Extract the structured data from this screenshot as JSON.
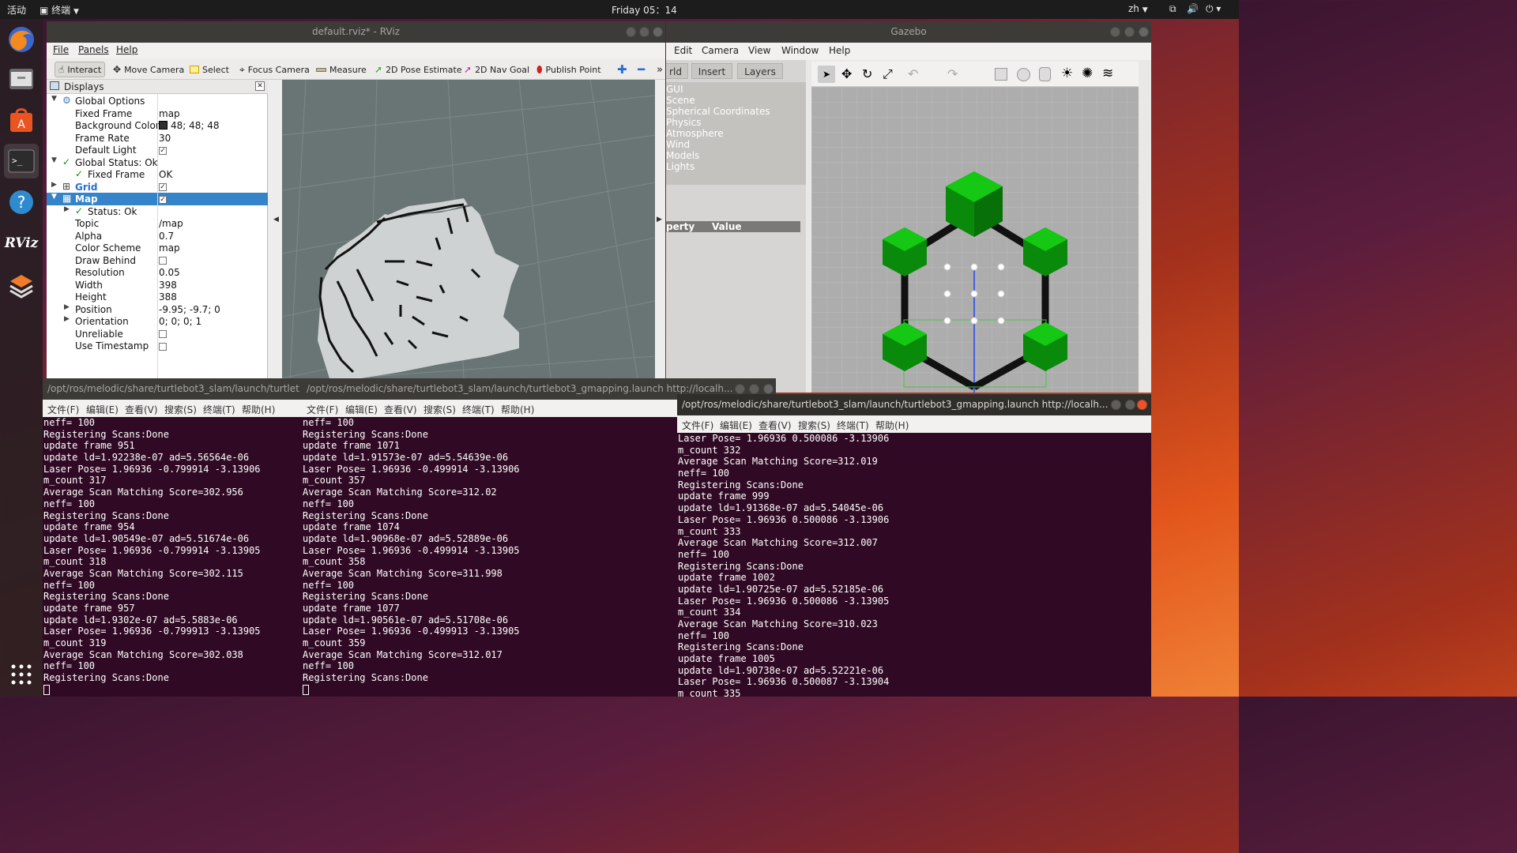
{
  "topbar": {
    "activities": "活动",
    "app_menu": "终端",
    "clock": "Friday 05：14",
    "lang": "zh"
  },
  "dock": {
    "items": [
      "firefox-icon",
      "files-icon",
      "software-icon",
      "terminal-icon",
      "help-icon",
      "rviz-icon",
      "workspace-icon",
      "show-apps-icon"
    ],
    "rviz_label": "RViz"
  },
  "rviz": {
    "title": "default.rviz* - RViz",
    "menu": [
      "File",
      "Panels",
      "Help"
    ],
    "tools": [
      "Interact",
      "Move Camera",
      "Select",
      "Focus Camera",
      "Measure",
      "2D Pose Estimate",
      "2D Nav Goal",
      "Publish Point"
    ],
    "panel_title": "Displays",
    "rows": [
      {
        "name": "Global Options",
        "value": ""
      },
      {
        "name": "Fixed Frame",
        "value": "map"
      },
      {
        "name": "Background Color",
        "value": "48; 48; 48"
      },
      {
        "name": "Frame Rate",
        "value": "30"
      },
      {
        "name": "Default Light",
        "value": ""
      },
      {
        "name": "Global Status: Ok",
        "value": ""
      },
      {
        "name": "Fixed Frame",
        "value": "OK"
      },
      {
        "name": "Grid",
        "value": ""
      },
      {
        "name": "Map",
        "value": ""
      },
      {
        "name": "Status: Ok",
        "value": ""
      },
      {
        "name": "Topic",
        "value": "/map"
      },
      {
        "name": "Alpha",
        "value": "0.7"
      },
      {
        "name": "Color Scheme",
        "value": "map"
      },
      {
        "name": "Draw Behind",
        "value": ""
      },
      {
        "name": "Resolution",
        "value": "0.05"
      },
      {
        "name": "Width",
        "value": "398"
      },
      {
        "name": "Height",
        "value": "388"
      },
      {
        "name": "Position",
        "value": "-9.95; -9.7; 0"
      },
      {
        "name": "Orientation",
        "value": "0; 0; 0; 1"
      },
      {
        "name": "Unreliable",
        "value": ""
      },
      {
        "name": "Use Timestamp",
        "value": ""
      }
    ]
  },
  "gazebo": {
    "title": "Gazebo",
    "menu": [
      "Edit",
      "Camera",
      "View",
      "Window",
      "Help"
    ],
    "tabs": [
      "rld",
      "Insert",
      "Layers"
    ],
    "world_items": [
      "GUI",
      "Scene",
      "Spherical Coordinates",
      "Physics",
      "Atmosphere",
      "Wind",
      "Models",
      "Lights"
    ],
    "prop_header": {
      "property": "perty",
      "value": "Value"
    }
  },
  "term_menu": [
    "文件(F)",
    "编辑(E)",
    "查看(V)",
    "搜索(S)",
    "终端(T)",
    "帮助(H)"
  ],
  "term1": {
    "title": "/opt/ros/melodic/share/turtlebot3_slam/launch/turtlet",
    "lines": [
      "neff= 100",
      "Registering Scans:Done",
      "update frame 951",
      "update ld=1.92238e-07 ad=5.56564e-06",
      "Laser Pose= 1.96936 -0.799914 -3.13906",
      "m_count 317",
      "Average Scan Matching Score=302.956",
      "neff= 100",
      "Registering Scans:Done",
      "update frame 954",
      "update ld=1.90549e-07 ad=5.51674e-06",
      "Laser Pose= 1.96936 -0.799914 -3.13905",
      "m_count 318",
      "Average Scan Matching Score=302.115",
      "neff= 100",
      "Registering Scans:Done",
      "update frame 957",
      "update ld=1.9302e-07 ad=5.5883e-06",
      "Laser Pose= 1.96936 -0.799913 -3.13905",
      "m_count 319",
      "Average Scan Matching Score=302.038",
      "neff= 100",
      "Registering Scans:Done"
    ]
  },
  "term2": {
    "title": "/opt/ros/melodic/share/turtlebot3_slam/launch/turtlebot3_gmapping.launch http://localh...",
    "lines": [
      "neff= 100",
      "Registering Scans:Done",
      "update frame 1071",
      "update ld=1.91573e-07 ad=5.54639e-06",
      "Laser Pose= 1.96936 -0.499914 -3.13906",
      "m_count 357",
      "Average Scan Matching Score=312.02",
      "neff= 100",
      "Registering Scans:Done",
      "update frame 1074",
      "update ld=1.90968e-07 ad=5.52889e-06",
      "Laser Pose= 1.96936 -0.499914 -3.13905",
      "m_count 358",
      "Average Scan Matching Score=311.998",
      "neff= 100",
      "Registering Scans:Done",
      "update frame 1077",
      "update ld=1.90561e-07 ad=5.51708e-06",
      "Laser Pose= 1.96936 -0.499913 -3.13905",
      "m_count 359",
      "Average Scan Matching Score=312.017",
      "neff= 100",
      "Registering Scans:Done"
    ]
  },
  "term3": {
    "title": "/opt/ros/melodic/share/turtlebot3_slam/launch/turtlebot3_gmapping.launch http://localh...",
    "lines": [
      "Laser Pose= 1.96936 0.500086 -3.13906",
      "m_count 332",
      "Average Scan Matching Score=312.019",
      "neff= 100",
      "Registering Scans:Done",
      "update frame 999",
      "update ld=1.91368e-07 ad=5.54045e-06",
      "Laser Pose= 1.96936 0.500086 -3.13906",
      "m_count 333",
      "Average Scan Matching Score=312.007",
      "neff= 100",
      "Registering Scans:Done",
      "update frame 1002",
      "update ld=1.90725e-07 ad=5.52185e-06",
      "Laser Pose= 1.96936 0.500086 -3.13905",
      "m_count 334",
      "Average Scan Matching Score=310.023",
      "neff= 100",
      "Registering Scans:Done",
      "update frame 1005",
      "update ld=1.90738e-07 ad=5.52221e-06",
      "Laser Pose= 1.96936 0.500087 -3.13904",
      "m_count 335"
    ]
  }
}
